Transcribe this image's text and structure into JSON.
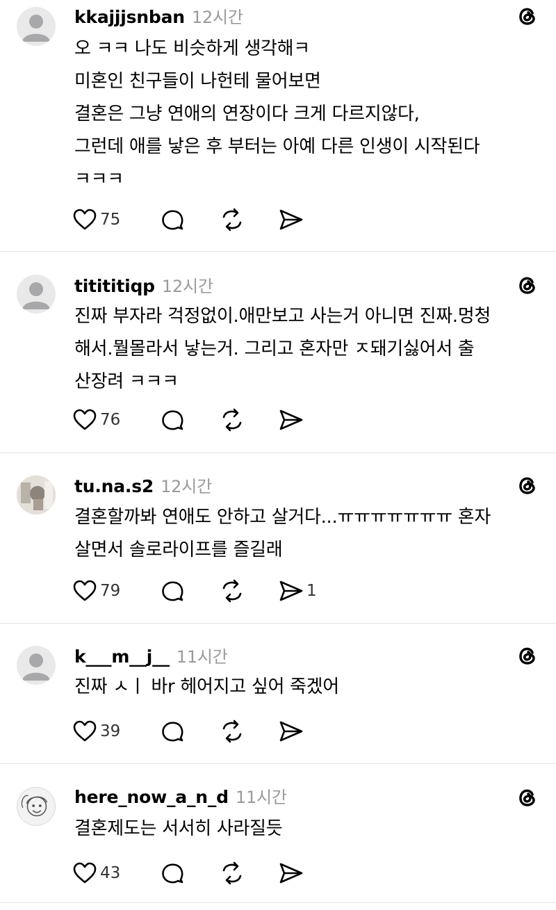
{
  "posts": [
    {
      "username": "kkajjjsnban",
      "time": "12시간",
      "text": "오 ㅋㅋ 나도 비슷하게 생각해ㅋ\n미혼인 친구들이 나헌테 물어보면\n결혼은 그냥 연애의 연장이다 크게 다르지않다,\n그런데 애를 낳은 후 부터는 아예 다른 인생이 시작된다\nㅋㅋㅋ",
      "likes": "75",
      "shares": "",
      "avatar": "default-avatar"
    },
    {
      "username": "titititiqp",
      "time": "12시간",
      "text": "진짜 부자라 걱정없이.애만보고 사는거 아니면 진짜.멍청\n해서.뭘몰라서 낳는거.  그리고 혼자만 ㅈ돼기싫어서 출\n산장려 ㅋㅋㅋ",
      "likes": "76",
      "shares": "",
      "avatar": "default-avatar"
    },
    {
      "username": "tu.na.s2",
      "time": "12시간",
      "text": "결혼할까봐 연애도 안하고 살거다...ㅠㅠㅠㅠㅠㅠㅠ 혼자\n살면서 솔로라이프를 즐길래",
      "likes": "79",
      "shares": "1",
      "avatar": "photo-avatar"
    },
    {
      "username": "k___m__j__",
      "time": "11시간",
      "text": "진짜 ㅅㅣ 바r 헤어지고 싶어 죽겠어",
      "likes": "39",
      "shares": "",
      "avatar": "default-avatar"
    },
    {
      "username": "here_now_a_n_d",
      "time": "11시간",
      "text": "결혼제도는 서서히 사라질듯",
      "likes": "43",
      "shares": "",
      "avatar": "drawing-avatar"
    }
  ]
}
